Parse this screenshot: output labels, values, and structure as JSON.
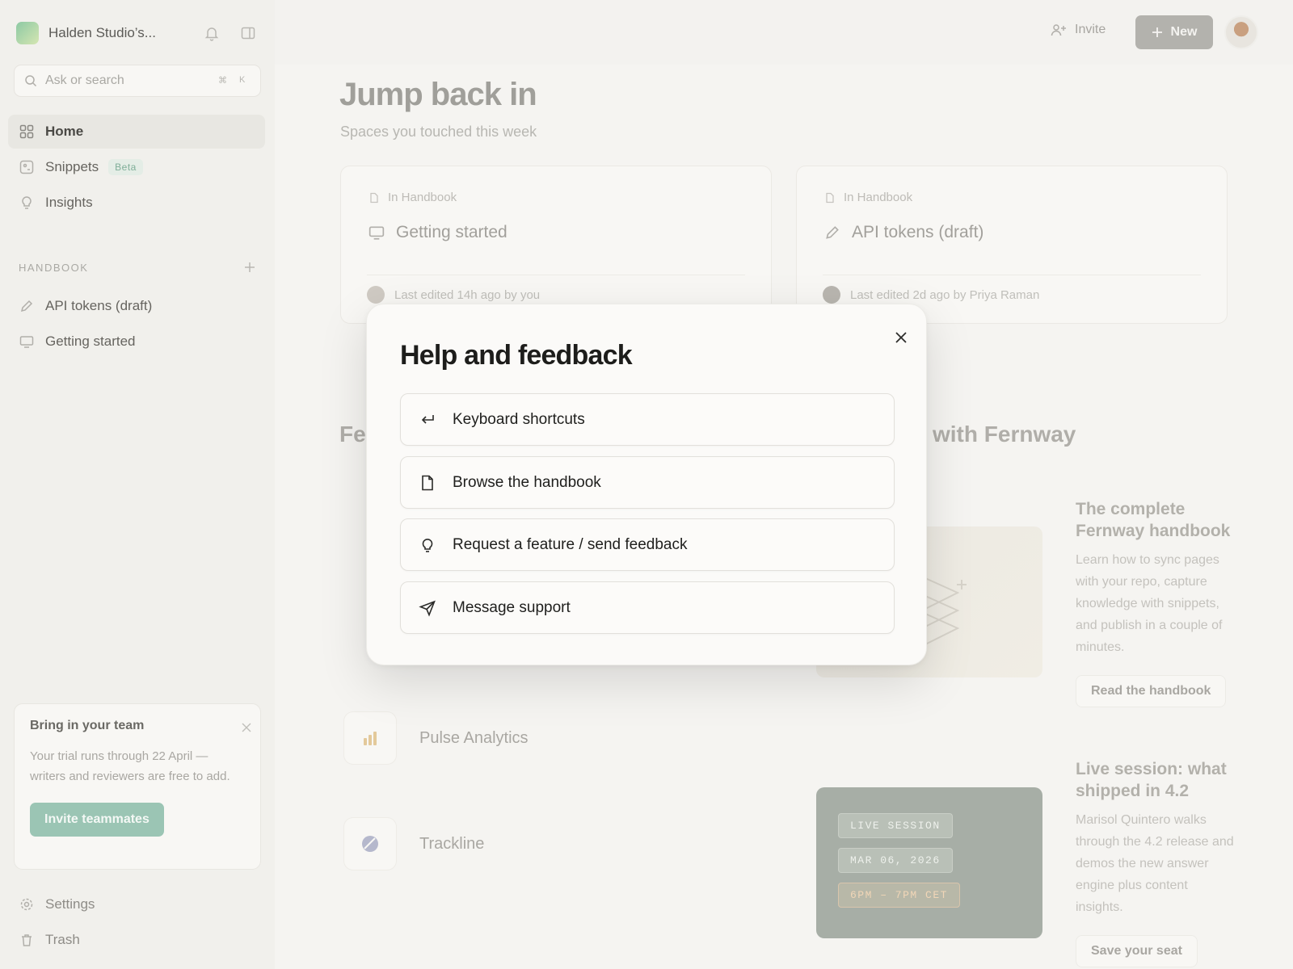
{
  "workspace": {
    "name": "Halden Studio’s..."
  },
  "search": {
    "placeholder": "Ask or search",
    "shortcut_mod": "⌘",
    "shortcut_key": "K"
  },
  "nav": [
    {
      "label": "Home",
      "icon": "grid-icon",
      "active": true
    },
    {
      "label": "Snippets",
      "icon": "snippet-icon",
      "badge": "Beta"
    },
    {
      "label": "Insights",
      "icon": "bulb-icon"
    }
  ],
  "handbook": {
    "section_label": "HANDBOOK",
    "items": [
      {
        "label": "API tokens (draft)",
        "icon": "pencil-icon"
      },
      {
        "label": "Getting started",
        "icon": "monitor-icon"
      }
    ]
  },
  "promo": {
    "title": "Bring in your team",
    "text": "Your trial runs through 22 April — writers and reviewers are free to add.",
    "button": "Invite teammates"
  },
  "footer_nav": [
    {
      "label": "Settings",
      "icon": "gear-icon"
    },
    {
      "label": "Trash",
      "icon": "trash-icon"
    }
  ],
  "topbar": {
    "invite": "Invite",
    "new": "New"
  },
  "main": {
    "title": "Jump back in",
    "subtitle": "Spaces you touched this week",
    "cards": [
      {
        "location": "In Handbook",
        "title": "Getting started",
        "meta": "Last edited 14h ago by you"
      },
      {
        "location": "In Handbook",
        "title": "API tokens (draft)",
        "meta": "Last edited 2d ago by Priya Raman"
      }
    ],
    "section_left_partial": "Fe",
    "section_right_partial": "with Fernway",
    "tools": [
      {
        "name": "Pulse Analytics",
        "icon": "bar-chart-icon"
      },
      {
        "name": "Trackline",
        "icon": "slash-circle-icon"
      }
    ],
    "read": {
      "title": "The complete Fernway handbook",
      "text": "Learn how to sync pages with your repo, capture knowledge with snippets, and publish in a couple of minutes.",
      "button": "Read the handbook"
    },
    "live": {
      "chips": [
        "LIVE SESSION",
        "MAR 06, 2026",
        "6PM – 7PM CET"
      ],
      "title": "Live session: what shipped in 4.2",
      "text": "Marisol Quintero walks through the 4.2 release and demos the new answer engine plus content insights.",
      "button": "Save your seat"
    }
  },
  "modal": {
    "title": "Help and feedback",
    "options": [
      {
        "label": "Keyboard shortcuts",
        "icon": "enter-arrow-icon"
      },
      {
        "label": "Browse the handbook",
        "icon": "document-icon"
      },
      {
        "label": "Request a feature / send feedback",
        "icon": "lightbulb-icon"
      },
      {
        "label": "Message support",
        "icon": "send-icon"
      }
    ]
  }
}
